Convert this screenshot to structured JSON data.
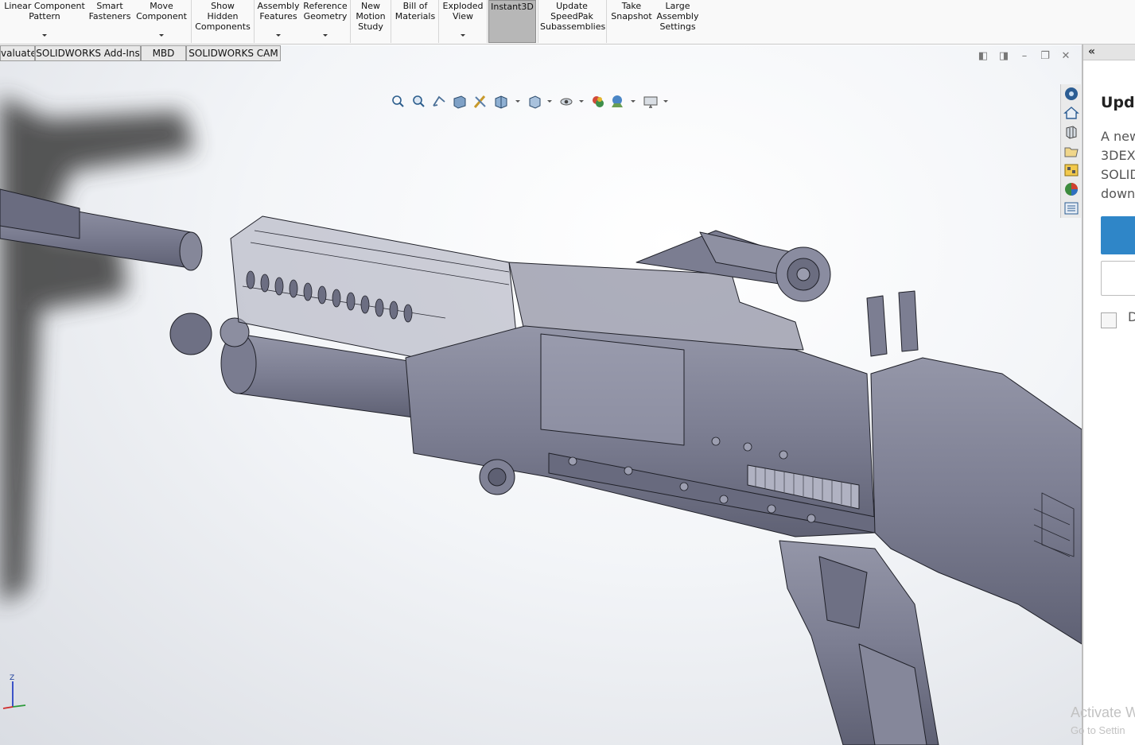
{
  "ribbon": {
    "buttons": [
      {
        "name": "linear-component-pattern",
        "lines": [
          "Linear Component",
          "Pattern"
        ],
        "dropdown": true
      },
      {
        "name": "smart-fasteners",
        "lines": [
          "Smart",
          "Fasteners"
        ],
        "dropdown": false
      },
      {
        "name": "move-component",
        "lines": [
          "Move",
          "Component"
        ],
        "dropdown": true
      },
      {
        "name": "show-hidden-components",
        "lines": [
          "Show",
          "Hidden",
          "Components"
        ],
        "dropdown": false
      },
      {
        "name": "assembly-features",
        "lines": [
          "Assembly",
          "Features"
        ],
        "dropdown": true
      },
      {
        "name": "reference-geometry",
        "lines": [
          "Reference",
          "Geometry"
        ],
        "dropdown": true
      },
      {
        "name": "new-motion-study",
        "lines": [
          "New",
          "Motion",
          "Study"
        ],
        "dropdown": false
      },
      {
        "name": "bill-of-materials",
        "lines": [
          "Bill of",
          "Materials"
        ],
        "dropdown": false
      },
      {
        "name": "exploded-view",
        "lines": [
          "Exploded",
          "View"
        ],
        "dropdown": true
      },
      {
        "name": "instant3d",
        "lines": [
          "Instant3D"
        ],
        "dropdown": false,
        "active": true
      },
      {
        "name": "update-speedpak-subassemblies",
        "lines": [
          "Update",
          "SpeedPak",
          "Subassemblies"
        ],
        "dropdown": false
      },
      {
        "name": "take-snapshot",
        "lines": [
          "Take",
          "Snapshot"
        ],
        "dropdown": false
      },
      {
        "name": "large-assembly-settings",
        "lines": [
          "Large",
          "Assembly",
          "Settings"
        ],
        "dropdown": false
      }
    ]
  },
  "tabs": [
    {
      "name": "tab-evaluate",
      "label": "valuate"
    },
    {
      "name": "tab-solidworks-add-ins",
      "label": "SOLIDWORKS Add-Ins"
    },
    {
      "name": "tab-mbd",
      "label": "MBD"
    },
    {
      "name": "tab-solidworks-cam",
      "label": "SOLIDWORKS CAM"
    }
  ],
  "heads_up_toolbar": [
    "zoom-to-fit-icon",
    "zoom-to-area-icon",
    "previous-view-icon",
    "section-view-icon",
    "dynamic-annotation-icon",
    "view-orientation-icon",
    "display-style-icon",
    "hide-show-items-icon",
    "edit-appearance-icon",
    "apply-scene-icon",
    "view-settings-icon"
  ],
  "window_controls": [
    "tile-left-icon",
    "tile-right-icon",
    "minimize-icon",
    "restore-icon",
    "close-icon"
  ],
  "task_pane_tabs": [
    "solidworks-resources-icon",
    "home-icon",
    "design-library-icon",
    "file-explorer-icon",
    "view-palette-icon",
    "appearances-scenes-icon",
    "custom-properties-icon"
  ],
  "triad": {
    "axis_z": "Z"
  },
  "panel": {
    "title": "Upda",
    "lines": [
      "A new",
      "3DEX",
      "SOLID",
      "downl"
    ],
    "checkbox_label": "D"
  },
  "watermark": {
    "line1": "Activate W",
    "line2": "Go to Settin"
  },
  "colors": {
    "model_fill": "#7e8094",
    "model_edge": "#1f2028",
    "primary_button": "#2f86c8",
    "active_ribbon": "#b7b7b7"
  }
}
